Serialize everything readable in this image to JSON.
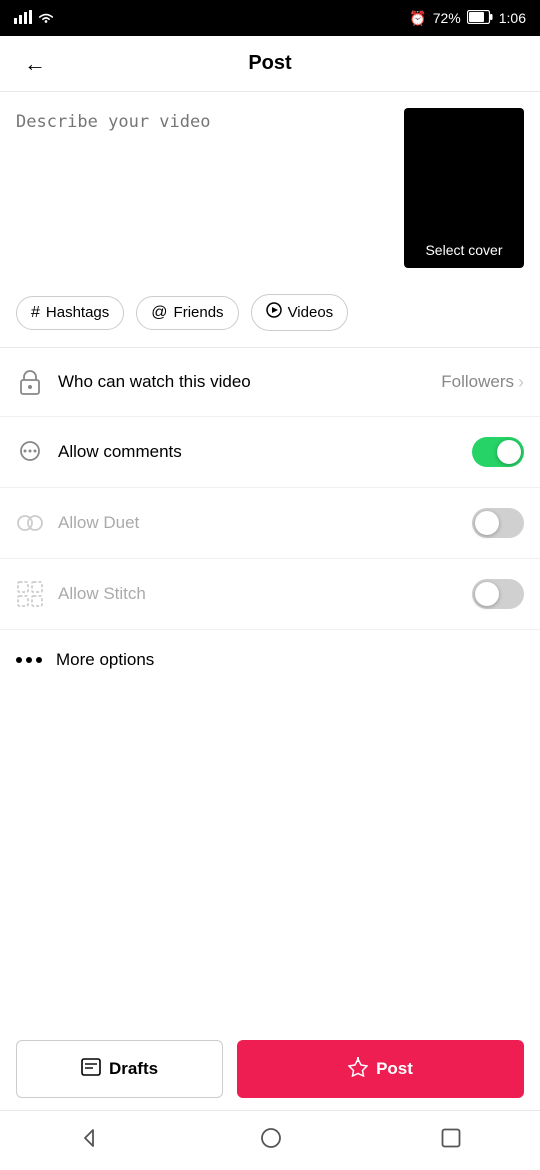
{
  "statusBar": {
    "signal": "▌▌▌",
    "wifi": "wifi",
    "alarm": "⏰",
    "battery": "72%",
    "time": "1:06"
  },
  "header": {
    "backLabel": "←",
    "title": "Post"
  },
  "descriptionPlaceholder": "Describe your video",
  "coverLabel": "Select cover",
  "tags": [
    {
      "icon": "#",
      "label": "Hashtags"
    },
    {
      "icon": "@",
      "label": "Friends"
    },
    {
      "icon": "▶",
      "label": "Videos"
    }
  ],
  "settings": [
    {
      "id": "who-can-watch",
      "label": "Who can watch this video",
      "value": "Followers",
      "hasChevron": true,
      "hasToggle": false,
      "muted": false,
      "toggleOn": false
    },
    {
      "id": "allow-comments",
      "label": "Allow comments",
      "value": "",
      "hasChevron": false,
      "hasToggle": true,
      "muted": false,
      "toggleOn": true
    },
    {
      "id": "allow-duet",
      "label": "Allow Duet",
      "value": "",
      "hasChevron": false,
      "hasToggle": true,
      "muted": true,
      "toggleOn": false
    },
    {
      "id": "allow-stitch",
      "label": "Allow Stitch",
      "value": "",
      "hasChevron": false,
      "hasToggle": true,
      "muted": true,
      "toggleOn": false
    }
  ],
  "moreOptions": "More options",
  "buttons": {
    "drafts": "Drafts",
    "post": "Post"
  },
  "colors": {
    "toggleOn": "#25D366",
    "toggleOff": "#d0d0d0",
    "postBtn": "#EE1D52"
  }
}
